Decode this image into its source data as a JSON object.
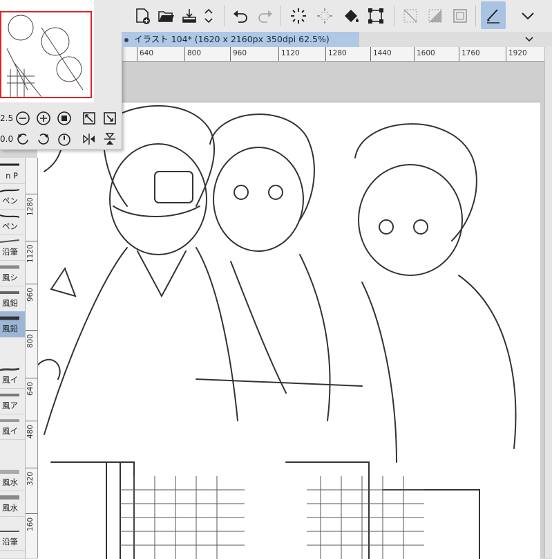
{
  "document_tab": {
    "title": "イラスト 104* (1620 x 2160px 350dpi 62.5%)"
  },
  "navigator": {
    "zoom_value": "2.5",
    "rotate_value": "0.0"
  },
  "rulers": {
    "horizontal_labels": [
      "640",
      "800",
      "960",
      "1120",
      "1280",
      "1440",
      "1600",
      "1760",
      "1920"
    ],
    "vertical_labels": [
      "1280",
      "1120",
      "960",
      "800",
      "640",
      "480",
      "320",
      "160"
    ]
  },
  "brushes": [
    {
      "label": "n P",
      "selected": false
    },
    {
      "label": "ペン",
      "selected": false
    },
    {
      "label": "ペン",
      "selected": false
    },
    {
      "label": "沿筆",
      "selected": false
    },
    {
      "label": "風シ",
      "selected": false
    },
    {
      "label": "風鉛",
      "selected": false
    },
    {
      "label": "風鉛",
      "selected": true
    },
    {
      "label": "風イ",
      "selected": false
    },
    {
      "label": "風ア",
      "selected": false
    },
    {
      "label": "風イ",
      "selected": false
    },
    {
      "label": "風水",
      "selected": false
    },
    {
      "label": "風水",
      "selected": false
    },
    {
      "label": "沿筆",
      "selected": false
    }
  ],
  "toolbar_icons": [
    "new-layer-icon",
    "open-icon",
    "export-icon",
    "updown-icon",
    "undo-icon",
    "redo-icon",
    "loading-icon",
    "select-dotted-icon",
    "fill-icon",
    "transform-icon",
    "deselect-icon",
    "invert-selection-icon",
    "selection-border-icon",
    "edit-pen-icon",
    "chevron-down-icon"
  ],
  "colors": {
    "accent": "#aec8e6",
    "selected": "#a9c4e2",
    "nav_frame": "#e0232a"
  }
}
